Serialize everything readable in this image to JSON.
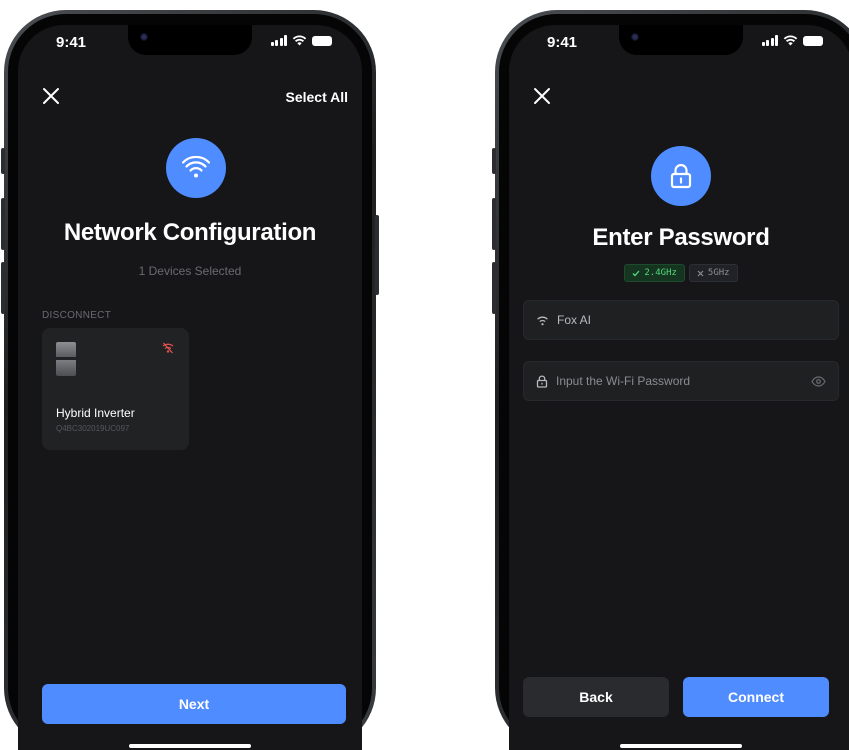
{
  "status": {
    "time": "9:41"
  },
  "left_screen": {
    "header": {
      "select_all_label": "Select All"
    },
    "title": "Network Configuration",
    "subtitle": "1 Devices Selected",
    "section_label": "DISCONNECT",
    "device": {
      "name": "Hybrid Inverter",
      "serial": "Q4BC302019UC097",
      "wifi_status": "disconnected"
    },
    "primary_button": "Next"
  },
  "right_screen": {
    "title": "Enter Password",
    "bands": [
      {
        "label": "2.4GHz",
        "supported": true
      },
      {
        "label": "5GHz",
        "supported": false
      }
    ],
    "ssid": {
      "value": "Fox AI"
    },
    "password": {
      "placeholder": "Input the Wi-Fi Password"
    },
    "back_button": "Back",
    "connect_button": "Connect"
  },
  "colors": {
    "accent": "#4f8cff",
    "background": "#161618",
    "card": "#212224",
    "success": "#55d67b",
    "error": "#e0524f"
  },
  "icons": [
    "close-icon",
    "wifi-icon",
    "lock-icon",
    "wifi-off-icon",
    "eye-icon",
    "check-icon",
    "cross-icon"
  ]
}
